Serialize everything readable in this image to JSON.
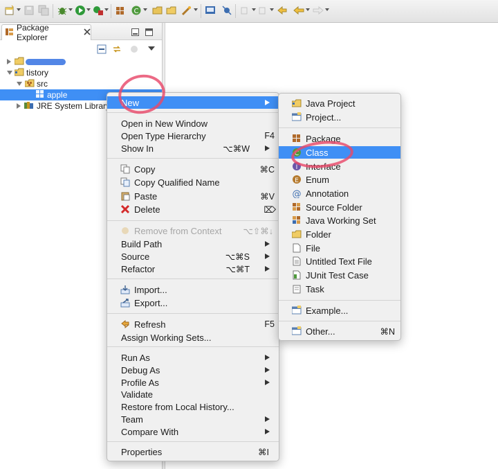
{
  "explorer": {
    "title": "Package Explorer",
    "tree": [
      {
        "label": "tistory",
        "kind": "project",
        "expanded": true
      },
      {
        "label": "src",
        "kind": "source-folder",
        "expanded": true
      },
      {
        "label": "apple",
        "kind": "package",
        "selected": true
      },
      {
        "label": "JRE System Library [",
        "kind": "library",
        "expanded": false
      }
    ]
  },
  "context_menu": {
    "items": [
      {
        "label": "New",
        "shortcut": "",
        "submenu": true,
        "highlighted": true
      },
      {
        "label": "Open in New Window",
        "shortcut": ""
      },
      {
        "label": "Open Type Hierarchy",
        "shortcut": "F4"
      },
      {
        "label": "Show In",
        "shortcut": "⌥⌘W",
        "submenu": true
      },
      {
        "label": "Copy",
        "shortcut": "⌘C",
        "icon": "copy-icon"
      },
      {
        "label": "Copy Qualified Name",
        "shortcut": "",
        "icon": "copy-qualified-icon"
      },
      {
        "label": "Paste",
        "shortcut": "⌘V",
        "icon": "paste-icon"
      },
      {
        "label": "Delete",
        "shortcut": "⌦",
        "icon": "delete-icon"
      },
      {
        "label": "Remove from Context",
        "shortcut": "⌥⇧⌘↓",
        "disabled": true,
        "icon": "remove-context-icon"
      },
      {
        "label": "Build Path",
        "shortcut": "",
        "submenu": true
      },
      {
        "label": "Source",
        "shortcut": "⌥⌘S",
        "submenu": true
      },
      {
        "label": "Refactor",
        "shortcut": "⌥⌘T",
        "submenu": true
      },
      {
        "label": "Import...",
        "shortcut": "",
        "icon": "import-icon"
      },
      {
        "label": "Export...",
        "shortcut": "",
        "icon": "export-icon"
      },
      {
        "label": "Refresh",
        "shortcut": "F5",
        "icon": "refresh-icon"
      },
      {
        "label": "Assign Working Sets...",
        "shortcut": ""
      },
      {
        "label": "Run As",
        "shortcut": "",
        "submenu": true
      },
      {
        "label": "Debug As",
        "shortcut": "",
        "submenu": true
      },
      {
        "label": "Profile As",
        "shortcut": "",
        "submenu": true
      },
      {
        "label": "Validate",
        "shortcut": ""
      },
      {
        "label": "Restore from Local History...",
        "shortcut": ""
      },
      {
        "label": "Team",
        "shortcut": "",
        "submenu": true
      },
      {
        "label": "Compare With",
        "shortcut": "",
        "submenu": true
      },
      {
        "label": "Properties",
        "shortcut": "⌘I"
      }
    ]
  },
  "new_submenu": {
    "items": [
      {
        "label": "Java Project",
        "icon": "java-project-icon"
      },
      {
        "label": "Project...",
        "icon": "project-icon"
      },
      {
        "label": "Package",
        "icon": "package-icon"
      },
      {
        "label": "Class",
        "icon": "class-icon",
        "highlighted": true
      },
      {
        "label": "Interface",
        "icon": "interface-icon"
      },
      {
        "label": "Enum",
        "icon": "enum-icon"
      },
      {
        "label": "Annotation",
        "icon": "annotation-icon"
      },
      {
        "label": "Source Folder",
        "icon": "source-folder-icon"
      },
      {
        "label": "Java Working Set",
        "icon": "working-set-icon"
      },
      {
        "label": "Folder",
        "icon": "folder-icon"
      },
      {
        "label": "File",
        "icon": "file-icon"
      },
      {
        "label": "Untitled Text File",
        "icon": "text-file-icon"
      },
      {
        "label": "JUnit Test Case",
        "icon": "junit-icon"
      },
      {
        "label": "Task",
        "icon": "task-icon"
      },
      {
        "label": "Example...",
        "icon": "example-icon"
      },
      {
        "label": "Other...",
        "icon": "other-icon",
        "shortcut": "⌘N"
      }
    ]
  },
  "colors": {
    "highlight": "#3f8ff5",
    "annotation": "#e8496a"
  }
}
